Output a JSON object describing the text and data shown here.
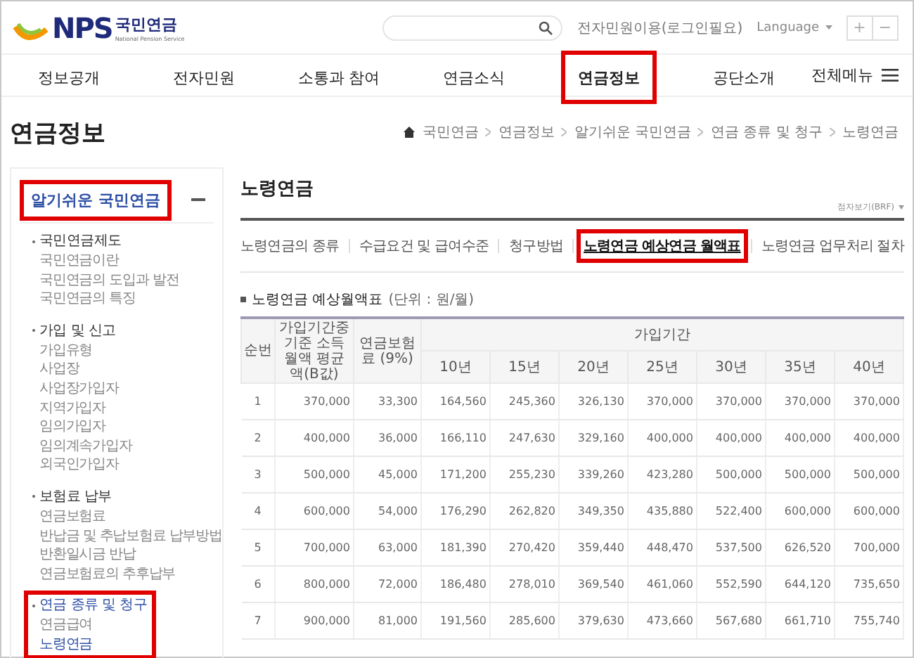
{
  "header": {
    "logo_mark": "NPS",
    "logo_text": "국민연금",
    "logo_sub": "National Pension Service",
    "login_link": "전자민원이용(로그인필요)",
    "language": "Language",
    "zoom_buttons": [
      "+",
      "−"
    ]
  },
  "nav": [
    {
      "label": "정보공개",
      "highlighted": false
    },
    {
      "label": "전자민원",
      "highlighted": false
    },
    {
      "label": "소통과 참여",
      "highlighted": false
    },
    {
      "label": "연금소식",
      "highlighted": false
    },
    {
      "label": "연금정보",
      "highlighted": true
    },
    {
      "label": "공단소개",
      "highlighted": false
    }
  ],
  "all_menu": "전체메뉴",
  "page_title": "연금정보",
  "breadcrumb": [
    "국민연금",
    "연금정보",
    "알기쉬운 국민연금",
    "연금 종류 및 청구",
    "노령연금"
  ],
  "sidebar": {
    "title": "알기쉬운 국민연금",
    "expanded": true,
    "highlighted": true,
    "groups": [
      {
        "label": "국민연금제도",
        "selected": false,
        "highlighted": false,
        "items": [
          {
            "label": "국민연금이란",
            "selected": false
          },
          {
            "label": "국민연금의 도입과 발전",
            "selected": false
          },
          {
            "label": "국민연금의 특징",
            "selected": false
          }
        ]
      },
      {
        "label": "가입 및 신고",
        "selected": false,
        "highlighted": false,
        "items": [
          {
            "label": "가입유형",
            "selected": false
          },
          {
            "label": "사업장",
            "selected": false
          },
          {
            "label": "사업장가입자",
            "selected": false
          },
          {
            "label": "지역가입자",
            "selected": false
          },
          {
            "label": "임의가입자",
            "selected": false
          },
          {
            "label": "임의계속가입자",
            "selected": false
          },
          {
            "label": "외국인가입자",
            "selected": false
          }
        ]
      },
      {
        "label": "보험료 납부",
        "selected": false,
        "highlighted": false,
        "items": [
          {
            "label": "연금보험료",
            "selected": false
          },
          {
            "label": "반납금 및 추납보험료 납부방법",
            "selected": false
          },
          {
            "label": "반환일시금 반납",
            "selected": false
          },
          {
            "label": "연금보험료의 추후납부",
            "selected": false
          }
        ]
      },
      {
        "label": "연금 종류 및 청구",
        "selected": true,
        "highlighted": true,
        "items": [
          {
            "label": "연금급여",
            "selected": false
          },
          {
            "label": "노령연금",
            "selected": true
          }
        ]
      }
    ]
  },
  "content": {
    "title": "노령연금",
    "braille_link": "점자보기(BRF)",
    "tabs": [
      {
        "label": "노령연금의 종류",
        "selected": false,
        "highlighted": false
      },
      {
        "label": "수급요건 및 급여수준",
        "selected": false,
        "highlighted": false
      },
      {
        "label": "청구방법",
        "selected": false,
        "highlighted": false
      },
      {
        "label": "노령연금 예상연금 월액표",
        "selected": true,
        "highlighted": true
      },
      {
        "label": "노령연금 업무처리 절차",
        "selected": false,
        "highlighted": false
      }
    ],
    "section_title": "노령연금 예상월액표",
    "unit": "(단위 : 원/월)",
    "table": {
      "columns": [
        "순번",
        "가입기간중 기준 소득월액 평균액(B값)",
        "연금보험료 (9%)"
      ],
      "group_header": "가입기간",
      "year_columns": [
        "10년",
        "15년",
        "20년",
        "25년",
        "30년",
        "35년",
        "40년"
      ],
      "rows": [
        [
          "1",
          "370,000",
          "33,300",
          "164,560",
          "245,360",
          "326,130",
          "370,000",
          "370,000",
          "370,000",
          "370,000"
        ],
        [
          "2",
          "400,000",
          "36,000",
          "166,110",
          "247,630",
          "329,160",
          "400,000",
          "400,000",
          "400,000",
          "400,000"
        ],
        [
          "3",
          "500,000",
          "45,000",
          "171,200",
          "255,230",
          "339,260",
          "423,280",
          "500,000",
          "500,000",
          "500,000"
        ],
        [
          "4",
          "600,000",
          "54,000",
          "176,290",
          "262,820",
          "349,350",
          "435,880",
          "522,400",
          "600,000",
          "600,000"
        ],
        [
          "5",
          "700,000",
          "63,000",
          "181,390",
          "270,420",
          "359,440",
          "448,470",
          "537,500",
          "626,520",
          "700,000"
        ],
        [
          "6",
          "800,000",
          "72,000",
          "186,480",
          "278,010",
          "369,540",
          "461,060",
          "552,590",
          "644,120",
          "735,650"
        ],
        [
          "7",
          "900,000",
          "81,000",
          "191,560",
          "285,600",
          "379,630",
          "473,660",
          "567,680",
          "661,710",
          "755,740"
        ]
      ]
    }
  }
}
